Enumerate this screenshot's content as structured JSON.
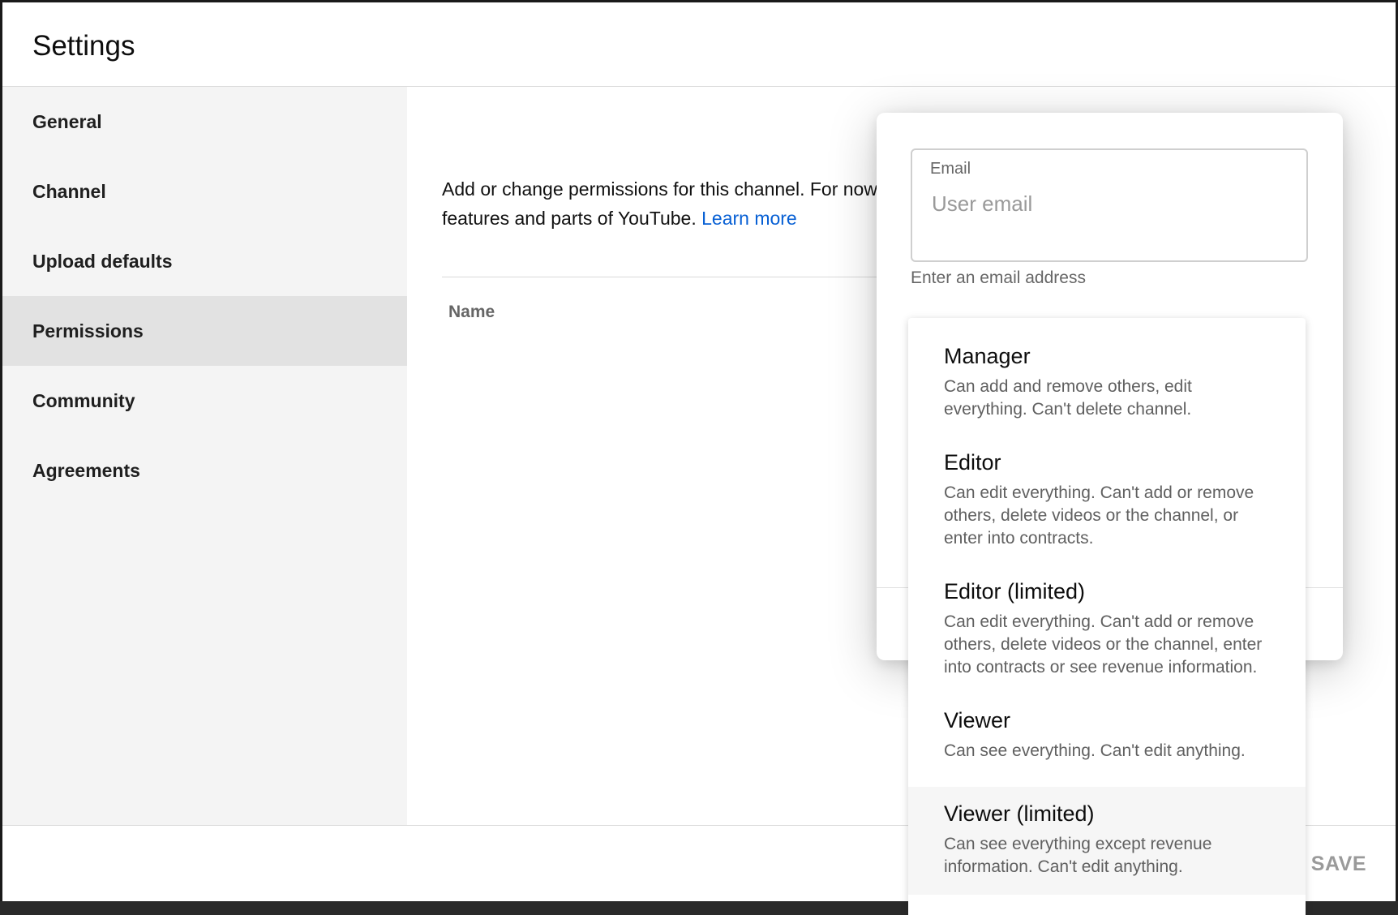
{
  "page_title": "Settings",
  "sidebar": {
    "items": [
      {
        "label": "General"
      },
      {
        "label": "Channel"
      },
      {
        "label": "Upload defaults"
      },
      {
        "label": "Permissions",
        "active": true
      },
      {
        "label": "Community"
      },
      {
        "label": "Agreements"
      }
    ]
  },
  "content": {
    "description_text": "Add or change permissions for this channel. For now",
    "description_text_2": "features and parts of YouTube. ",
    "learn_more": "Learn more",
    "column_name": "Name"
  },
  "dialog": {
    "email_label": "Email",
    "email_placeholder": "User email",
    "email_value": "",
    "email_hint": "Enter an email address"
  },
  "roles": [
    {
      "title": "Manager",
      "desc": "Can add and remove others, edit everything. Can't delete channel."
    },
    {
      "title": "Editor",
      "desc": "Can edit everything. Can't add or remove others, delete videos or the channel, or enter into contracts."
    },
    {
      "title": "Editor (limited)",
      "desc": "Can edit everything. Can't add or remove others, delete videos or the channel, enter into contracts or see revenue information."
    },
    {
      "title": "Viewer",
      "desc": "Can see everything. Can't edit anything."
    },
    {
      "title": "Viewer (limited)",
      "desc": "Can see everything except revenue information. Can't edit anything."
    }
  ],
  "footer": {
    "save_label": "SAVE"
  },
  "colors": {
    "link": "#065fd4",
    "sidebar_bg": "#f4f4f4",
    "active_bg": "#e2e2e2"
  }
}
